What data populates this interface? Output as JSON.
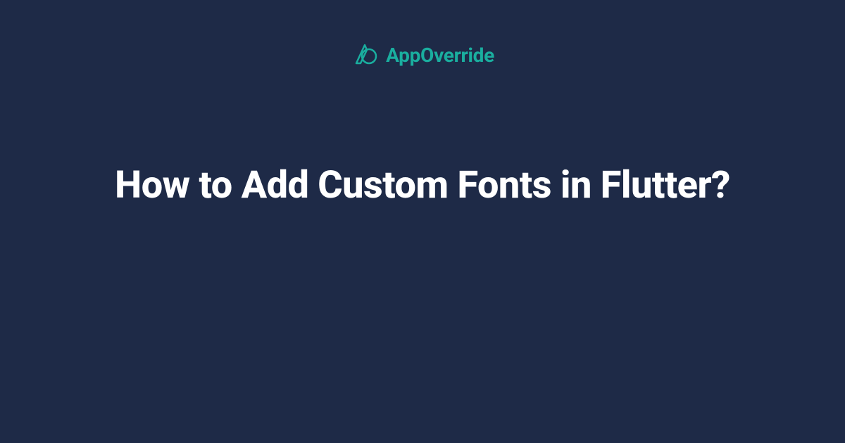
{
  "brand": {
    "name": "AppOverride",
    "accent_color": "#1aae9f"
  },
  "content": {
    "title": "How to Add Custom Fonts in Flutter?"
  },
  "colors": {
    "background": "#1e2a47",
    "title_text": "#ffffff"
  }
}
